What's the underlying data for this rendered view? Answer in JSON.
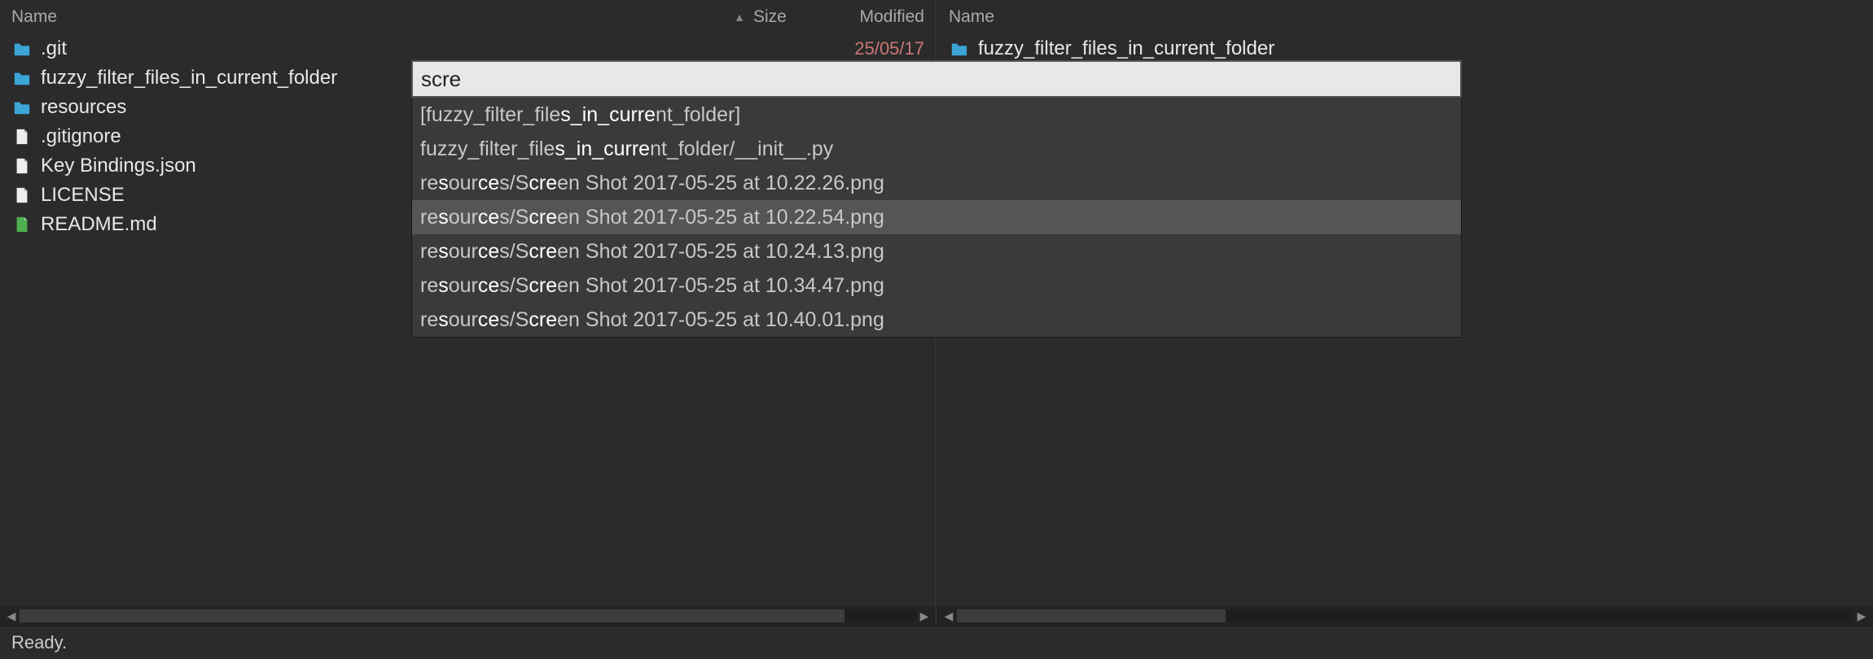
{
  "headers": {
    "name": "Name",
    "size": "Size",
    "modified": "Modified",
    "sort_indicator": "▲"
  },
  "left_pane": {
    "items": [
      {
        "name": ".git",
        "type": "folder",
        "modified": "25/05/17"
      },
      {
        "name": "fuzzy_filter_files_in_current_folder",
        "type": "folder"
      },
      {
        "name": "resources",
        "type": "folder"
      },
      {
        "name": ".gitignore",
        "type": "file"
      },
      {
        "name": "Key Bindings.json",
        "type": "file"
      },
      {
        "name": "LICENSE",
        "type": "file"
      },
      {
        "name": "README.md",
        "type": "markdown"
      }
    ]
  },
  "right_pane": {
    "items": [
      {
        "name": "fuzzy_filter_files_in_current_folder",
        "type": "folder"
      }
    ]
  },
  "fuzzy": {
    "query": "scre",
    "results": [
      {
        "text": "[fuzzy_filter_files_in_current_folder]",
        "hl_start": 18,
        "hl_end": 27,
        "selected": false
      },
      {
        "text": "fuzzy_filter_files_in_current_folder/__init__.py",
        "hl_start": 18,
        "hl_end": 27,
        "selected": false
      },
      {
        "text": "resources/Screen Shot 2017-05-25 at 10.22.26.png",
        "selected": false
      },
      {
        "text": "resources/Screen Shot 2017-05-25 at 10.22.54.png",
        "selected": true
      },
      {
        "text": "resources/Screen Shot 2017-05-25 at 10.24.13.png",
        "selected": false
      },
      {
        "text": "resources/Screen Shot 2017-05-25 at 10.34.47.png",
        "selected": false
      },
      {
        "text": "resources/Screen Shot 2017-05-25 at 10.40.01.png",
        "selected": false
      }
    ]
  },
  "status": {
    "text": "Ready."
  }
}
